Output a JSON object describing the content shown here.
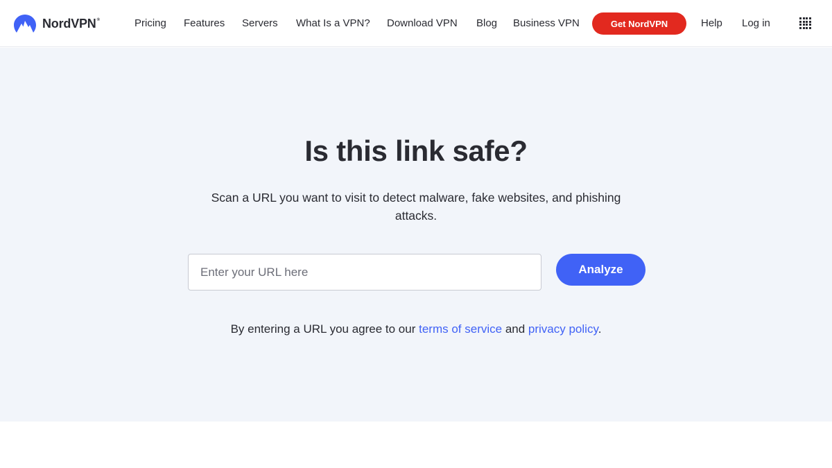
{
  "header": {
    "logo_text": "NordVPN",
    "logo_reg": "®",
    "nav": [
      {
        "label": "Pricing"
      },
      {
        "label": "Features"
      },
      {
        "label": "Servers"
      },
      {
        "label": "What Is a VPN?"
      },
      {
        "label": "Download VPN"
      },
      {
        "label": "Blog"
      },
      {
        "label": "Business VPN"
      }
    ],
    "cta_label": "Get NordVPN",
    "help_label": "Help",
    "login_label": "Log in",
    "apps_icon": "grid-menu-icon"
  },
  "hero": {
    "title": "Is this link safe?",
    "subtitle": "Scan a URL you want to visit to detect malware, fake websites, and phishing attacks.",
    "input_value": "",
    "input_placeholder": "Enter your URL here",
    "analyze_label": "Analyze",
    "agree_prefix": "By entering a URL you agree to our ",
    "terms_label": "terms of service",
    "agree_middle": " and ",
    "privacy_label": "privacy policy",
    "agree_suffix": "."
  },
  "colors": {
    "brand_blue": "#4062f6",
    "cta_red": "#e2291f",
    "hero_bg": "#f2f5fa",
    "text": "#2a2b32"
  }
}
